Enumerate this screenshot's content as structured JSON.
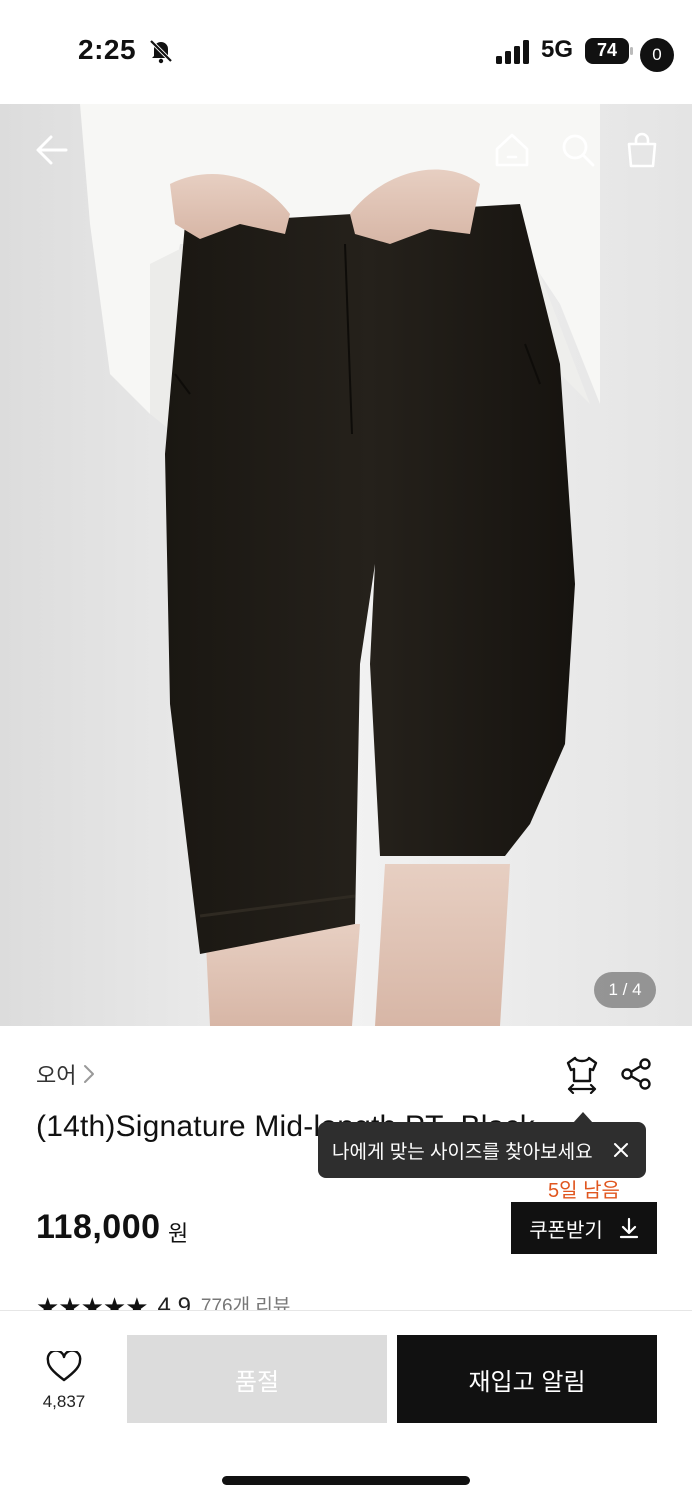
{
  "status_bar": {
    "time": "2:25",
    "network": "5G",
    "battery": "74"
  },
  "gallery": {
    "current": "1 / 4"
  },
  "cart": {
    "count": "0"
  },
  "product": {
    "brand": "오어",
    "title": "(14th)Signature Mid-length PT_Black",
    "price": "118,000",
    "currency": "원",
    "days_left": "5일 남음",
    "coupon_label": "쿠폰받기",
    "rating": "4.9",
    "review_count": "776개 리뷰",
    "rating_fraction": 0.98
  },
  "tooltip": {
    "text": "나에게 맞는 사이즈를 찾아보세요"
  },
  "bottom_bar": {
    "wish_count": "4,837",
    "soldout_label": "품절",
    "restock_label": "재입고 알림"
  },
  "icons": [
    "back-arrow-icon",
    "home-icon",
    "search-icon",
    "shopping-bag-icon",
    "chevron-right-icon",
    "size-guide-icon",
    "share-icon",
    "close-icon",
    "download-icon",
    "heart-icon"
  ]
}
